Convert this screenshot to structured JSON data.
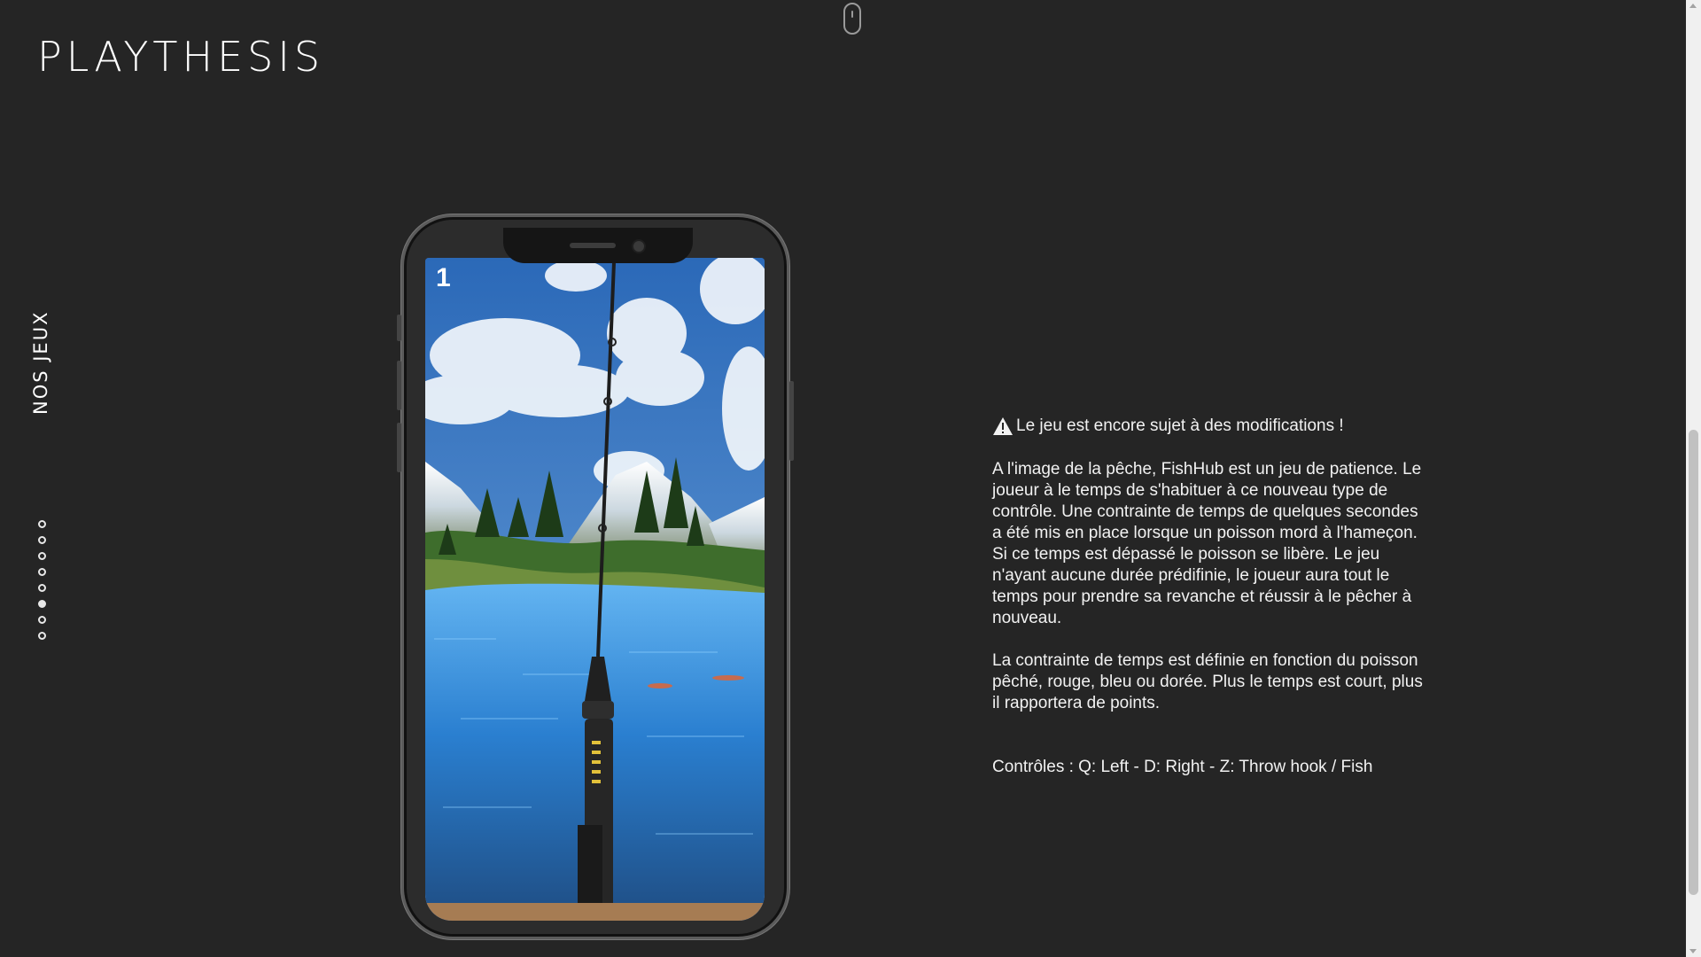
{
  "header": {
    "logo": "PLAYTHESIS",
    "scroll_icon": "mouse-icon"
  },
  "sidebar": {
    "section_title": "NOS JEUX",
    "pages": [
      {
        "active": false
      },
      {
        "active": false
      },
      {
        "active": false
      },
      {
        "active": false
      },
      {
        "active": false
      },
      {
        "active": true
      },
      {
        "active": false
      },
      {
        "active": false
      }
    ]
  },
  "game_preview": {
    "level": "1",
    "device_icon": "phone-frame",
    "scene_icon": "fishing-scene"
  },
  "info": {
    "warning_icon": "warning-triangle-icon",
    "warning": "Le jeu est encore sujet à des modifications !",
    "description_1": "A l'image de la pêche, FishHub est un jeu de patience. Le joueur à le temps de s'habituer à ce nouveau type de contrôle. Une contrainte de temps de quelques secondes a été mis en place lorsque un poisson mord à l'hameçon. Si ce temps est dépassé le poisson se libère. Le jeu n'ayant aucune durée prédifinie, le joueur aura tout le temps pour prendre sa revanche et réussir à le pêcher à nouveau.",
    "description_2": "La contrainte de temps est définie en fonction du poisson pêché, rouge, bleu ou dorée. Plus le temps est court, plus il rapportera de points.",
    "controls": "Contrôles : Q: Left - D: Right - Z: Throw hook / Fish"
  },
  "colors": {
    "background": "#252525",
    "text": "#f2f2f2"
  }
}
